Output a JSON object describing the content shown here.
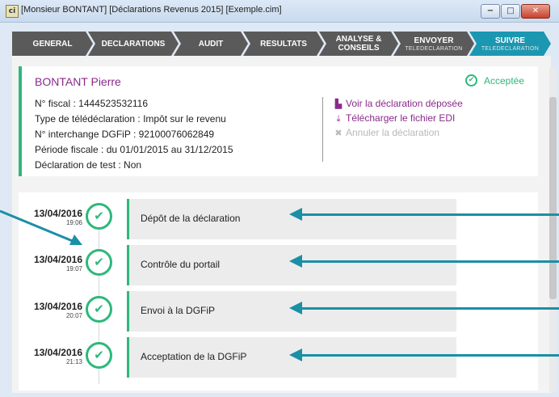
{
  "window": {
    "title": "[Monsieur BONTANT] [Déclarations Revenus 2015] [Exemple.cim]",
    "app_icon": "ci",
    "controls": {
      "minimize": "−",
      "maximize": "□",
      "close": "✕"
    }
  },
  "nav": {
    "tabs": [
      {
        "label": "GENERAL",
        "sub": ""
      },
      {
        "label": "DECLARATIONS",
        "sub": ""
      },
      {
        "label": "AUDIT",
        "sub": ""
      },
      {
        "label": "RESULTATS",
        "sub": ""
      },
      {
        "label": "ANALYSE &",
        "label2": "CONSEILS",
        "sub": ""
      },
      {
        "label": "ENVOYER",
        "sub": "TELEDECLARATION"
      },
      {
        "label": "SUIVRE",
        "sub": "TELEDECLARATION"
      }
    ],
    "active_tab": "SUIVRE"
  },
  "declaration": {
    "name": "BONTANT Pierre",
    "status": "Acceptée",
    "fields": [
      "N° fiscal : 1444523532116",
      "Type de télédéclaration : Impôt sur le revenu",
      "N° interchange DGFiP : 92100076062849",
      "Période fiscale : du 01/01/2015 au 31/12/2015",
      "Déclaration de test : Non"
    ],
    "actions": {
      "view": "Voir la déclaration déposée",
      "download": "Télécharger le fichier EDI",
      "cancel": "Annuler la déclaration"
    }
  },
  "timeline": [
    {
      "date": "13/04/2016",
      "time": "19:06",
      "label": "Dépôt de la déclaration"
    },
    {
      "date": "13/04/2016",
      "time": "19:07",
      "label": "Contrôle du portail"
    },
    {
      "date": "13/04/2016",
      "time": "20:07",
      "label": "Envoi à la DGFiP"
    },
    {
      "date": "13/04/2016",
      "time": "21:13",
      "label": "Acceptation de la DGFiP"
    }
  ],
  "icons": {
    "check": "✔",
    "document": "▙",
    "download": "⤓",
    "cancel": "✖"
  },
  "colors": {
    "accent": "#2db87b",
    "nav_active": "#1b97b1",
    "nav_tab": "#5a5a5a",
    "annotation_arrow": "#1b8fa6",
    "link": "#8a2a8a"
  }
}
